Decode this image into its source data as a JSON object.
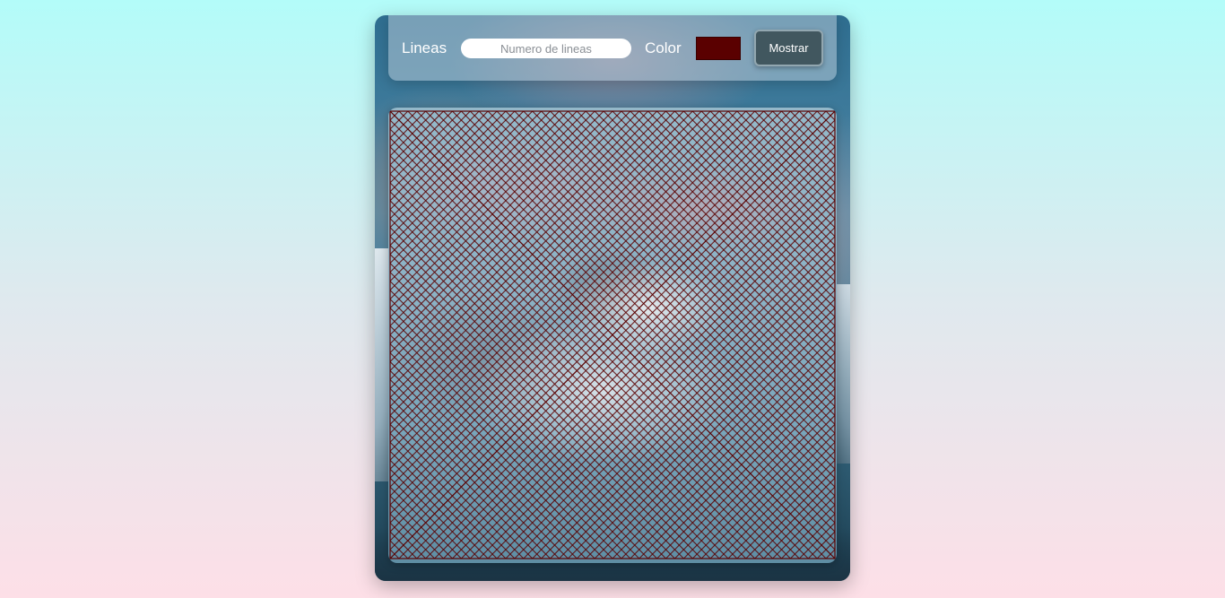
{
  "toolbar": {
    "lines_label": "Lineas",
    "lines_placeholder": "Numero de lineas",
    "lines_value": "",
    "color_label": "Color",
    "color_value": "#5a0000",
    "show_button_label": "Mostrar"
  },
  "canvas": {
    "line_count": 50,
    "line_color": "#5a0000",
    "pattern": "string-art curves on each side of the square"
  }
}
